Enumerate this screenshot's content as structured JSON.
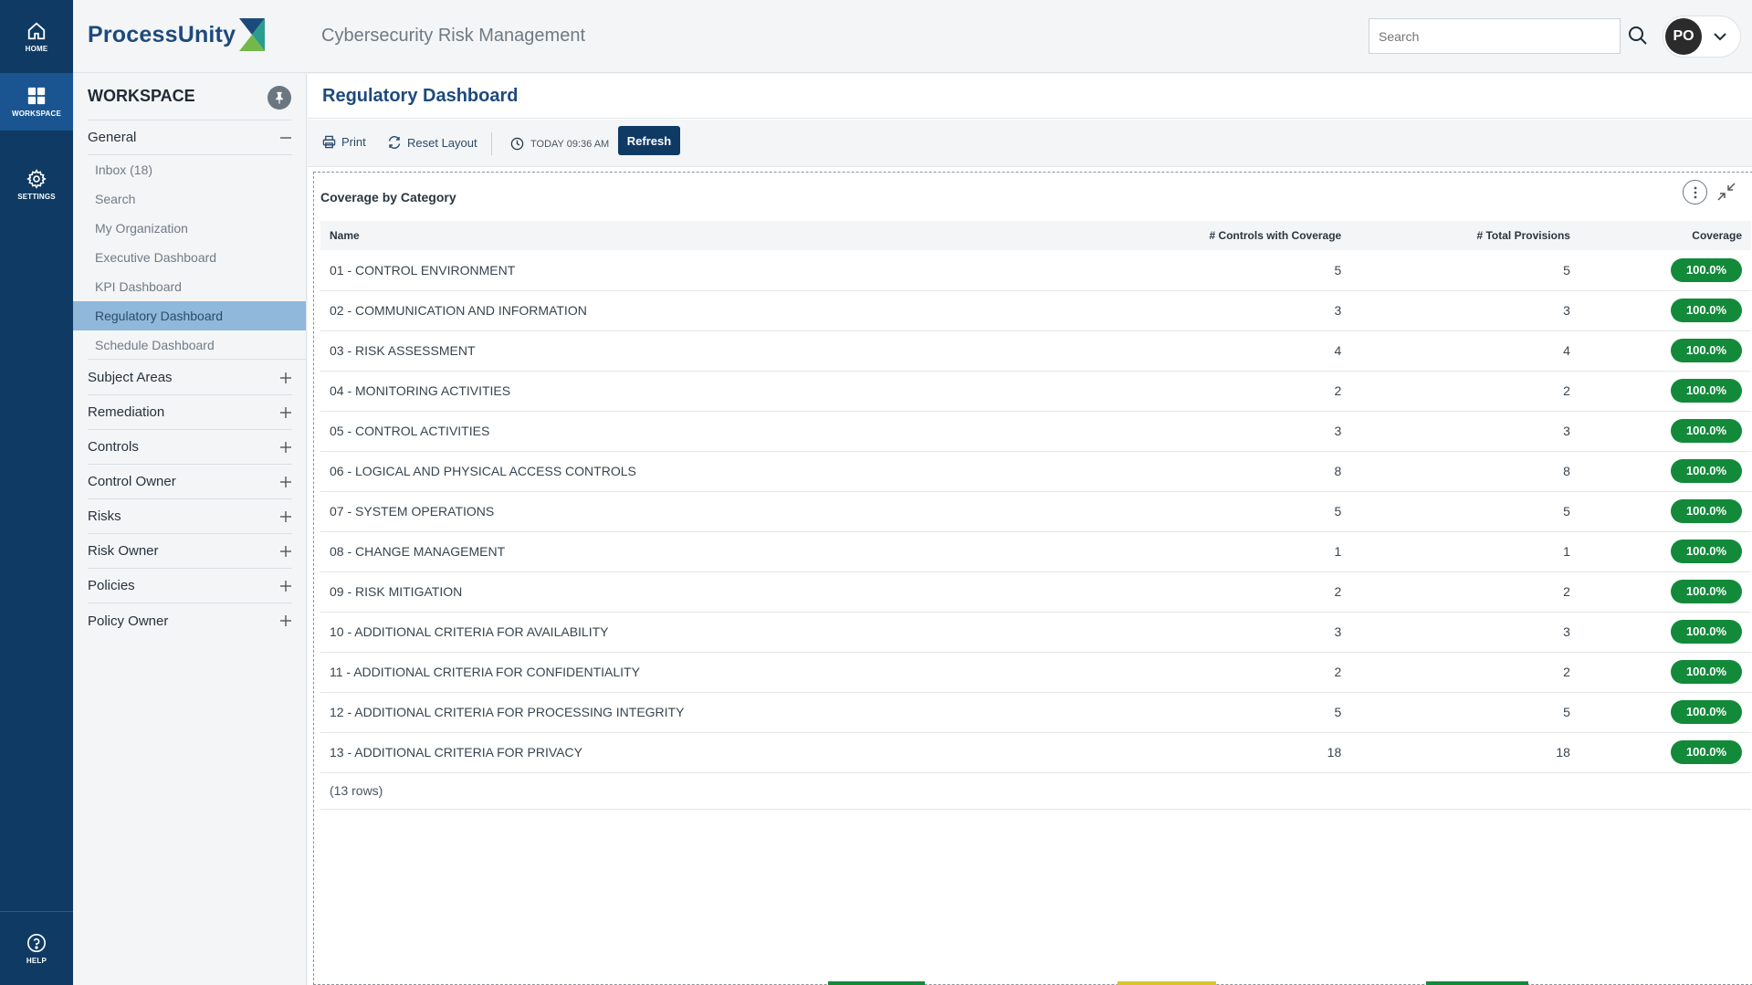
{
  "rail": {
    "home_label": "HOME",
    "workspace_label": "WORKSPACE",
    "settings_label": "SETTINGS",
    "help_label": "HELP",
    "active": "workspace"
  },
  "header": {
    "logo_text": "ProcessUnity",
    "app_title": "Cybersecurity Risk Management",
    "search_placeholder": "Search",
    "search_value": "",
    "user_initials": "PO"
  },
  "sidebar": {
    "title": "WORKSPACE",
    "general": {
      "label": "General",
      "expanded": true,
      "items": [
        {
          "label": "Inbox (18)"
        },
        {
          "label": "Search"
        },
        {
          "label": "My Organization"
        },
        {
          "label": "Executive Dashboard"
        },
        {
          "label": "KPI Dashboard"
        },
        {
          "label": "Regulatory Dashboard",
          "selected": true
        },
        {
          "label": "Schedule Dashboard"
        }
      ]
    },
    "groups": [
      {
        "label": "Subject Areas"
      },
      {
        "label": "Remediation"
      },
      {
        "label": "Controls"
      },
      {
        "label": "Control Owner"
      },
      {
        "label": "Risks"
      },
      {
        "label": "Risk Owner"
      },
      {
        "label": "Policies"
      },
      {
        "label": "Policy Owner"
      }
    ]
  },
  "main": {
    "page_title": "Regulatory Dashboard",
    "toolbar": {
      "print_label": "Print",
      "reset_label": "Reset Layout",
      "timestamp": "TODAY 09:36 AM",
      "refresh_label": "Refresh"
    },
    "panel": {
      "title": "Coverage by Category",
      "columns": [
        "Name",
        "# Controls with Coverage",
        "# Total Provisions",
        "Coverage"
      ],
      "rows": [
        {
          "name": "01 - CONTROL ENVIRONMENT",
          "controls": "5",
          "provisions": "5",
          "coverage": "100.0%"
        },
        {
          "name": "02 - COMMUNICATION AND INFORMATION",
          "controls": "3",
          "provisions": "3",
          "coverage": "100.0%"
        },
        {
          "name": "03 - RISK ASSESSMENT",
          "controls": "4",
          "provisions": "4",
          "coverage": "100.0%"
        },
        {
          "name": "04 - MONITORING ACTIVITIES",
          "controls": "2",
          "provisions": "2",
          "coverage": "100.0%"
        },
        {
          "name": "05 - CONTROL ACTIVITIES",
          "controls": "3",
          "provisions": "3",
          "coverage": "100.0%"
        },
        {
          "name": "06 - LOGICAL AND PHYSICAL ACCESS CONTROLS",
          "controls": "8",
          "provisions": "8",
          "coverage": "100.0%"
        },
        {
          "name": "07 - SYSTEM OPERATIONS",
          "controls": "5",
          "provisions": "5",
          "coverage": "100.0%"
        },
        {
          "name": "08 - CHANGE MANAGEMENT",
          "controls": "1",
          "provisions": "1",
          "coverage": "100.0%"
        },
        {
          "name": "09 - RISK MITIGATION",
          "controls": "2",
          "provisions": "2",
          "coverage": "100.0%"
        },
        {
          "name": "10 - ADDITIONAL CRITERIA FOR AVAILABILITY",
          "controls": "3",
          "provisions": "3",
          "coverage": "100.0%"
        },
        {
          "name": "11 - ADDITIONAL CRITERIA FOR CONFIDENTIALITY",
          "controls": "2",
          "provisions": "2",
          "coverage": "100.0%"
        },
        {
          "name": "12 - ADDITIONAL CRITERIA FOR PROCESSING INTEGRITY",
          "controls": "5",
          "provisions": "5",
          "coverage": "100.0%"
        },
        {
          "name": "13 - ADDITIONAL CRITERIA FOR PRIVACY",
          "controls": "18",
          "provisions": "18",
          "coverage": "100.0%"
        }
      ],
      "row_count": "(13 rows)"
    }
  },
  "colors": {
    "rail_bg": "#0f3a63",
    "rail_active": "#1a5591",
    "brand_blue": "#1d4a7c",
    "selected_nav": "#8fb8db",
    "coverage_badge": "#138a3a"
  },
  "icons": [
    "home-icon",
    "grid-icon",
    "gear-icon",
    "help-icon",
    "search-icon",
    "chevron-down-icon",
    "pin-icon",
    "minus-icon",
    "plus-icon",
    "print-icon",
    "reset-icon",
    "clock-icon",
    "kebab-icon",
    "collapse-icon"
  ]
}
